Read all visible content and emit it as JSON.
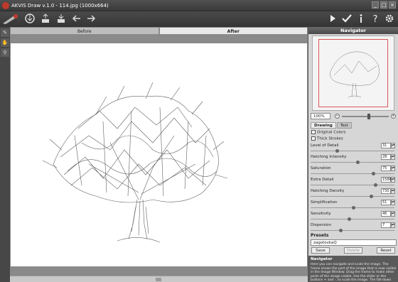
{
  "window": {
    "title": "AKVIS Draw v.1.0 - 114.jpg (1000x664)",
    "controls": [
      "_",
      "□",
      "×"
    ]
  },
  "toolbar": {
    "left_icons": [
      "logo-icon",
      "open-icon",
      "save-icon",
      "print-icon",
      "back-icon",
      "forward-icon"
    ],
    "right_icons": [
      "run-icon",
      "apply-icon",
      "info-icon",
      "help-icon",
      "settings-icon"
    ]
  },
  "left_tools": [
    "eraser-tool-icon",
    "hand-tool-icon",
    "zoom-tool-icon"
  ],
  "view_tabs": [
    {
      "label": "Before",
      "active": false
    },
    {
      "label": "After",
      "active": true
    }
  ],
  "navigator": {
    "title": "Navigator",
    "zoom": "100%",
    "minus": "−",
    "plus": "+"
  },
  "panel_tabs": [
    {
      "label": "Drawing",
      "active": true
    },
    {
      "label": "Text",
      "active": false
    }
  ],
  "options": [
    {
      "label": "Original Colors",
      "checked": false
    },
    {
      "label": "Thick Strokes",
      "checked": false
    }
  ],
  "parameters": [
    {
      "label": "Level of Detail",
      "value": "31",
      "fraction": 0.31
    },
    {
      "label": "Hatching Intensity",
      "value": "28",
      "fraction": 0.56
    },
    {
      "label": "Saturation",
      "value": "75",
      "fraction": 0.75
    },
    {
      "label": "Extra Detail",
      "value": "1586",
      "fraction": 0.78
    },
    {
      "label": "Hatching Density",
      "value": "730",
      "fraction": 0.73
    },
    {
      "label": "Simplification",
      "value": "51",
      "fraction": 0.51
    },
    {
      "label": "Sensitivity",
      "value": "46",
      "fraction": 0.46
    },
    {
      "label": "Dispersion",
      "value": "7",
      "fraction": 0.35
    }
  ],
  "presets": {
    "title": "Presets",
    "selected": "zagotovkaQ",
    "save_label": "Save",
    "delete_label": "Delete",
    "reset_label": "Reset"
  },
  "help": {
    "title": "Navigator",
    "text": "Here you can navigate and scale the image. The frame shows the part of the image that is now visible in the Image Window. Drag the frame to make other parts of the image visible. Use the slider or the buttons + and -, to scale the image. The fall-down menu shows some frequently used coefficients."
  }
}
